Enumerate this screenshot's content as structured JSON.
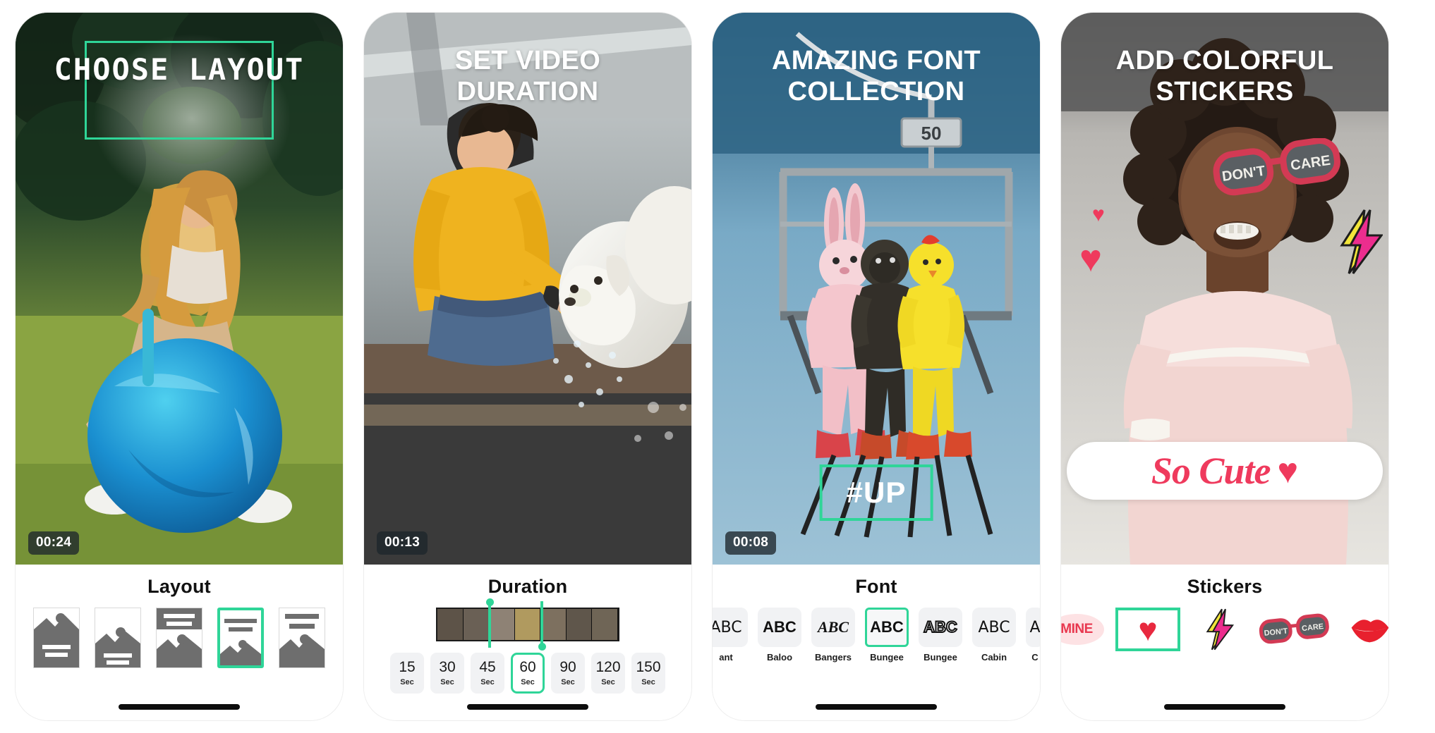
{
  "app_showcase": {
    "panels": [
      {
        "id": "layout",
        "headline": "CHOOSE LAYOUT",
        "timestamp": "00:24",
        "section_title": "Layout",
        "selected_index": 3,
        "options": [
          {
            "name": "layout-image-top-text-bottom"
          },
          {
            "name": "layout-image-center-text-bottom"
          },
          {
            "name": "layout-text-top-image-bottom"
          },
          {
            "name": "layout-text-top-small-image"
          },
          {
            "name": "layout-text-band-image"
          }
        ]
      },
      {
        "id": "duration",
        "headline": "SET VIDEO DURATION",
        "timestamp": "00:13",
        "section_title": "Duration",
        "selected_index": 3,
        "options": [
          {
            "value": "15",
            "unit": "Sec"
          },
          {
            "value": "30",
            "unit": "Sec"
          },
          {
            "value": "45",
            "unit": "Sec"
          },
          {
            "value": "60",
            "unit": "Sec"
          },
          {
            "value": "90",
            "unit": "Sec"
          },
          {
            "value": "120",
            "unit": "Sec"
          },
          {
            "value": "150",
            "unit": "Sec"
          }
        ]
      },
      {
        "id": "font",
        "headline": "AMAZING FONT COLLECTION",
        "timestamp": "00:08",
        "section_title": "Font",
        "overlay_text": "#UP",
        "chairlift_number": "50",
        "selected_index": 3,
        "options": [
          {
            "sample": "ABC",
            "name": "ant",
            "style": "plain"
          },
          {
            "sample": "ABC",
            "name": "Baloo",
            "style": "bold"
          },
          {
            "sample": "ABC",
            "name": "Bangers",
            "style": "italic"
          },
          {
            "sample": "ABC",
            "name": "Bungee",
            "style": "bold"
          },
          {
            "sample": "ABC",
            "name": "Bungee",
            "style": "outline"
          },
          {
            "sample": "ABC",
            "name": "Cabin",
            "style": "plain"
          },
          {
            "sample": "A",
            "name": "C",
            "style": "plain"
          }
        ]
      },
      {
        "id": "stickers",
        "headline": "ADD COLORFUL STICKERS",
        "section_title": "Stickers",
        "overlay_sticker_text": "So Cute",
        "glasses_text_left": "DON'T",
        "glasses_text_right": "CARE",
        "selected_index": 1,
        "options": [
          {
            "name": "mine-sticker",
            "label": "MINE"
          },
          {
            "name": "heart-sticker",
            "label": "♥"
          },
          {
            "name": "lightning-sticker",
            "label": "⚡"
          },
          {
            "name": "dont-care-glasses-sticker",
            "label": "DON'T CARE"
          },
          {
            "name": "lips-sticker",
            "label": "👄"
          }
        ]
      }
    ]
  },
  "colors": {
    "accent_green": "#2fd598",
    "sticker_pink": "#ef3a5d",
    "font_tile_bg": "#f1f2f4",
    "panel_bg": "#ffffff"
  }
}
